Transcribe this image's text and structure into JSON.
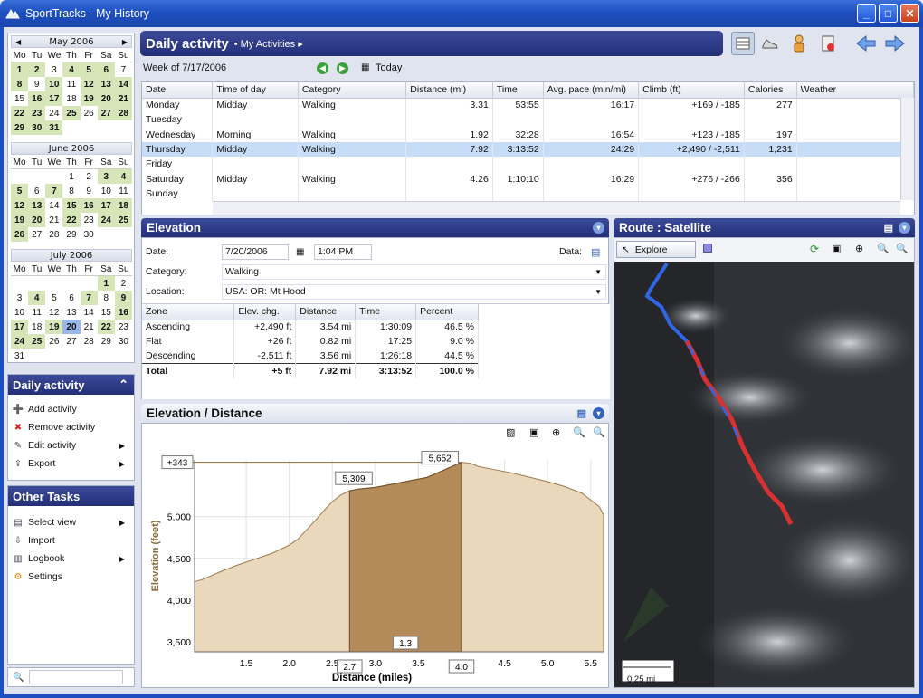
{
  "window": {
    "title": "SportTracks - My History"
  },
  "calendar": {
    "dow": [
      "Mo",
      "Tu",
      "We",
      "Th",
      "Fr",
      "Sa",
      "Su"
    ],
    "months": [
      {
        "title": "May 2006",
        "days": [
          {
            "d": "1",
            "h": 1
          },
          {
            "d": "2",
            "h": 1
          },
          {
            "d": "3"
          },
          {
            "d": "4",
            "h": 1
          },
          {
            "d": "5",
            "h": 1
          },
          {
            "d": "6",
            "h": 1
          },
          {
            "d": "7"
          },
          {
            "d": "8",
            "h": 1
          },
          {
            "d": "9"
          },
          {
            "d": "10",
            "h": 1
          },
          {
            "d": "11"
          },
          {
            "d": "12",
            "h": 1
          },
          {
            "d": "13",
            "h": 1
          },
          {
            "d": "14",
            "h": 1
          },
          {
            "d": "15"
          },
          {
            "d": "16",
            "h": 1
          },
          {
            "d": "17",
            "h": 1
          },
          {
            "d": "18"
          },
          {
            "d": "19",
            "h": 1
          },
          {
            "d": "20",
            "h": 1
          },
          {
            "d": "21",
            "h": 1
          },
          {
            "d": "22",
            "h": 1
          },
          {
            "d": "23",
            "h": 1
          },
          {
            "d": "24"
          },
          {
            "d": "25",
            "h": 1
          },
          {
            "d": "26"
          },
          {
            "d": "27",
            "h": 1
          },
          {
            "d": "28",
            "h": 1
          },
          {
            "d": "29",
            "h": 1
          },
          {
            "d": "30",
            "h": 1
          },
          {
            "d": "31",
            "h": 1
          }
        ]
      },
      {
        "title": "June 2006",
        "lead": 3,
        "days": [
          {
            "d": "1"
          },
          {
            "d": "2"
          },
          {
            "d": "3",
            "h": 1
          },
          {
            "d": "4",
            "h": 1
          },
          {
            "d": "5",
            "h": 1
          },
          {
            "d": "6"
          },
          {
            "d": "7",
            "h": 1
          },
          {
            "d": "8"
          },
          {
            "d": "9"
          },
          {
            "d": "10"
          },
          {
            "d": "11"
          },
          {
            "d": "12",
            "h": 1
          },
          {
            "d": "13",
            "h": 1
          },
          {
            "d": "14"
          },
          {
            "d": "15",
            "h": 1
          },
          {
            "d": "16",
            "h": 1
          },
          {
            "d": "17",
            "h": 1
          },
          {
            "d": "18",
            "h": 1
          },
          {
            "d": "19",
            "h": 1
          },
          {
            "d": "20",
            "h": 1
          },
          {
            "d": "21"
          },
          {
            "d": "22",
            "h": 1
          },
          {
            "d": "23"
          },
          {
            "d": "24",
            "h": 1
          },
          {
            "d": "25",
            "h": 1
          },
          {
            "d": "26",
            "h": 1
          },
          {
            "d": "27"
          },
          {
            "d": "28"
          },
          {
            "d": "29"
          },
          {
            "d": "30"
          }
        ]
      },
      {
        "title": "July 2006",
        "lead": 5,
        "days": [
          {
            "d": "1",
            "h": 1
          },
          {
            "d": "2"
          },
          {
            "d": "3"
          },
          {
            "d": "4",
            "h": 1
          },
          {
            "d": "5"
          },
          {
            "d": "6"
          },
          {
            "d": "7",
            "h": 1
          },
          {
            "d": "8"
          },
          {
            "d": "9",
            "h": 1
          },
          {
            "d": "10"
          },
          {
            "d": "11"
          },
          {
            "d": "12"
          },
          {
            "d": "13"
          },
          {
            "d": "14"
          },
          {
            "d": "15"
          },
          {
            "d": "16",
            "h": 1
          },
          {
            "d": "17",
            "h": 1
          },
          {
            "d": "18"
          },
          {
            "d": "19",
            "h": 1
          },
          {
            "d": "20",
            "s": 1
          },
          {
            "d": "21"
          },
          {
            "d": "22",
            "h": 1
          },
          {
            "d": "23"
          },
          {
            "d": "24",
            "h": 1
          },
          {
            "d": "25",
            "h": 1
          },
          {
            "d": "26"
          },
          {
            "d": "27"
          },
          {
            "d": "28"
          },
          {
            "d": "29"
          },
          {
            "d": "30"
          },
          {
            "d": "31"
          }
        ]
      }
    ]
  },
  "daily_panel": {
    "title": "Daily activity",
    "items": [
      {
        "label": "Add activity",
        "icon": "add-icon",
        "sub": false
      },
      {
        "label": "Remove activity",
        "icon": "remove-icon",
        "sub": false
      },
      {
        "label": "Edit activity",
        "icon": "edit-icon",
        "sub": true
      },
      {
        "label": "Export",
        "icon": "export-icon",
        "sub": true
      }
    ]
  },
  "other_panel": {
    "title": "Other Tasks",
    "items": [
      {
        "label": "Select view",
        "icon": "view-icon",
        "sub": true
      },
      {
        "label": "Import",
        "icon": "import-icon",
        "sub": false
      },
      {
        "label": "Logbook",
        "icon": "logbook-icon",
        "sub": true
      },
      {
        "label": "Settings",
        "icon": "settings-icon",
        "sub": false
      }
    ]
  },
  "header": {
    "title": "Daily activity",
    "crumb": "My Activities"
  },
  "week": {
    "label": "Week of 7/17/2006",
    "today": "Today"
  },
  "activity_table": {
    "columns": [
      "Date",
      "Time of day",
      "Category",
      "Distance (mi)",
      "Time",
      "Avg. pace (min/mi)",
      "Climb (ft)",
      "Calories",
      "Weather"
    ],
    "rows": [
      [
        "Monday",
        "Midday",
        "Walking",
        "3.31",
        "53:55",
        "16:17",
        "+169 / -185",
        "277",
        ""
      ],
      [
        "Tuesday",
        "",
        "",
        "",
        "",
        "",
        "",
        "",
        ""
      ],
      [
        "Wednesday",
        "Morning",
        "Walking",
        "1.92",
        "32:28",
        "16:54",
        "+123 / -185",
        "197",
        ""
      ],
      [
        "Thursday",
        "Midday",
        "Walking",
        "7.92",
        "3:13:52",
        "24:29",
        "+2,490 / -2,511",
        "1,231",
        ""
      ],
      [
        "Friday",
        "",
        "",
        "",
        "",
        "",
        "",
        "",
        ""
      ],
      [
        "Saturday",
        "Midday",
        "Walking",
        "4.26",
        "1:10:10",
        "16:29",
        "+276 / -266",
        "356",
        ""
      ],
      [
        "Sunday",
        "",
        "",
        "",
        "",
        "",
        "",
        "",
        ""
      ]
    ]
  },
  "elevation": {
    "title": "Elevation",
    "date_label": "Date:",
    "date": "7/20/2006",
    "time": "1:04 PM",
    "data_label": "Data:",
    "category_label": "Category:",
    "category": "Walking",
    "location_label": "Location:",
    "location": "USA: OR: Mt Hood",
    "columns": [
      "Zone",
      "Elev. chg.",
      "Distance",
      "Time",
      "Percent"
    ],
    "rows": [
      [
        "Ascending",
        "+2,490 ft",
        "3.54 mi",
        "1:30:09",
        "46.5 %"
      ],
      [
        "Flat",
        "+26 ft",
        "0.82 mi",
        "17:25",
        "9.0 %"
      ],
      [
        "Descending",
        "-2,511 ft",
        "3.56 mi",
        "1:26:18",
        "44.5 %"
      ]
    ],
    "total": [
      "Total",
      "+5 ft",
      "7.92 mi",
      "3:13:52",
      "100.0 %"
    ]
  },
  "chart_panel": {
    "title": "Elevation / Distance"
  },
  "chart_data": {
    "type": "area",
    "xlabel": "Distance (miles)",
    "ylabel": "Elevation (feet)",
    "xlim": [
      0.9,
      5.65
    ],
    "ylim": [
      3380,
      5680
    ],
    "xticks": [
      1.5,
      2.0,
      2.5,
      3.0,
      3.5,
      4.0,
      4.5,
      5.0,
      5.5
    ],
    "xtick_labels": [
      "1.5",
      "2.0",
      "2.5",
      "3.0",
      "3.5",
      "4.0",
      "4.5",
      "5.0",
      "5.5"
    ],
    "yticks": [
      3500,
      4000,
      4500,
      5000
    ],
    "ytick_labels": [
      "3,500",
      "4,000",
      "4,500",
      "5,000"
    ],
    "x": [
      0.9,
      1.0,
      1.2,
      1.4,
      1.6,
      1.8,
      2.0,
      2.1,
      2.2,
      2.3,
      2.4,
      2.5,
      2.6,
      2.7,
      2.8,
      3.0,
      3.2,
      3.4,
      3.6,
      3.8,
      4.0,
      4.1,
      4.2,
      4.4,
      4.6,
      4.8,
      5.0,
      5.2,
      5.4,
      5.5,
      5.6,
      5.65
    ],
    "y": [
      4220,
      4250,
      4340,
      4420,
      4490,
      4560,
      4660,
      4730,
      4840,
      4950,
      5070,
      5180,
      5260,
      5309,
      5330,
      5350,
      5390,
      5430,
      5470,
      5560,
      5652,
      5640,
      5600,
      5560,
      5520,
      5470,
      5420,
      5360,
      5280,
      5200,
      5120,
      5020
    ],
    "selection": {
      "x_start": 2.7,
      "x_end": 4.0
    },
    "annotations": [
      "+343",
      "5,309",
      "5,652",
      "1.3",
      "2.7",
      "4.0"
    ],
    "grid": true
  },
  "route": {
    "title": "Route : Satellite",
    "explore": "Explore",
    "scale": "0.25 mi"
  }
}
